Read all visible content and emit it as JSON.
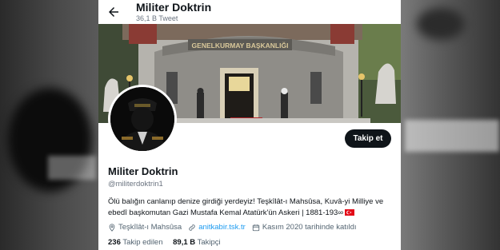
{
  "header": {
    "title": "Militer Doktrin",
    "subtitle": "36,1 B Tweet"
  },
  "banner": {
    "sign_text": "GENELKURMAY BAŞKANLIĞI"
  },
  "profile": {
    "name": "Militer Doktrin",
    "handle": "@militerdoktrin1",
    "bio_line1": "Ölü balığın canlanıp denize girdiği yerdeyiz! Teşkîlât-ı Mahsûsa, Kuvâ-yi Milliye ve",
    "bio_line2": "ebedî başkomutan Gazi Mustafa Kemal Atatürk'ün Askeri | 1881-193∞",
    "location": "Teşkîlât-ı Mahsûsa",
    "website": "anitkabir.tsk.tr",
    "joined": "Kasım 2020 tarihinde katıldı",
    "following_count": "236",
    "following_label": "Takip edilen",
    "followers_count": "89,1 B",
    "followers_label": "Takipçi",
    "follow_button": "Takip et"
  },
  "colors": {
    "accent_link": "#1d9bf0",
    "button_bg": "#0f1419",
    "flag_red": "#e30a17"
  },
  "icons": [
    "back-arrow-icon",
    "location-pin-icon",
    "link-icon",
    "calendar-icon",
    "turkish-flag-icon"
  ]
}
